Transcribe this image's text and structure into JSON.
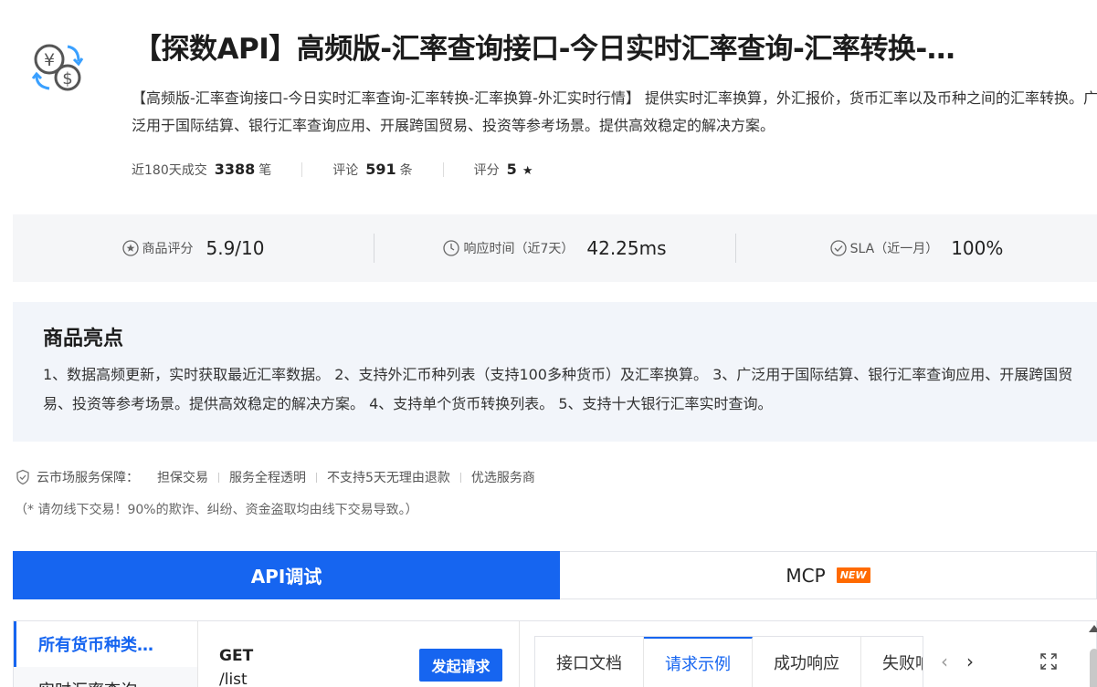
{
  "product": {
    "title": "【探数API】高频版-汇率查询接口-今日实时汇率查询-汇率转换-…",
    "description": "【高频版-汇率查询接口-今日实时汇率查询-汇率转换-汇率换算-外汇实时行情】 提供实时汇率换算，外汇报价，货币汇率以及币种之间的汇率转换。广泛用于国际结算、银行汇率查询应用、开展跨国贸易、投资等参考场景。提供高效稳定的解决方案。",
    "icon": "currency-exchange-icon"
  },
  "stats": {
    "sales_label": "近180天成交",
    "sales_value": "3388",
    "sales_unit": "笔",
    "reviews_label": "评论",
    "reviews_value": "591",
    "reviews_unit": "条",
    "rating_label": "评分",
    "rating_value": "5",
    "rating_star": "★"
  },
  "metrics": {
    "score_label": "商品评分",
    "score_value": "5.9/10",
    "response_label": "响应时间（近7天）",
    "response_value": "42.25ms",
    "sla_label": "SLA（近一月）",
    "sla_value": "100%"
  },
  "highlights": {
    "title": "商品亮点",
    "text": "1、数据高频更新，实时获取最近汇率数据。 2、支持外汇币种列表（支持100多种货币）及汇率换算。 3、广泛用于国际结算、银行汇率查询应用、开展跨国贸易、投资等参考场景。提供高效稳定的解决方案。 4、支持单个货币转换列表。 5、支持十大银行汇率实时查询。"
  },
  "guarantee": {
    "label": "云市场服务保障：",
    "items": [
      "担保交易",
      "服务全程透明",
      "不支持5天无理由退款",
      "优选服务商"
    ],
    "warning": "（* 请勿线下交易！90%的欺诈、纠纷、资金盗取均由线下交易导致。）"
  },
  "tabs": {
    "api": "API调试",
    "mcp": "MCP",
    "mcp_badge": "NEW"
  },
  "sidebar": {
    "items": [
      "所有货币种类…",
      "实时汇率查询…"
    ]
  },
  "request": {
    "method": "GET",
    "path": "/list",
    "send_label": "发起请求"
  },
  "doc_tabs": [
    "接口文档",
    "请求示例",
    "成功响应",
    "失败响应"
  ],
  "nav": {
    "prev": "‹",
    "next": "›"
  },
  "colors": {
    "primary": "#1665f0",
    "badge": "#ff6a00"
  }
}
